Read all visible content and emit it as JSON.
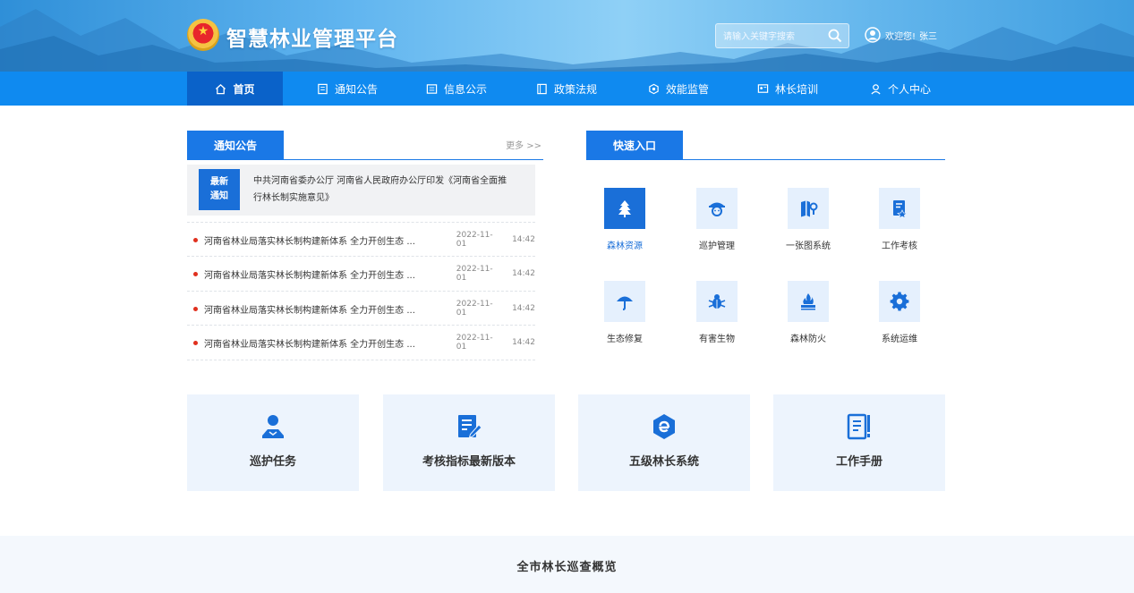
{
  "header": {
    "app_title": "智慧林业管理平台",
    "search_placeholder": "请输入关键字搜索",
    "welcome": "欢迎您!",
    "username": "张三"
  },
  "nav": {
    "items": [
      {
        "label": "首页",
        "icon": "home-icon"
      },
      {
        "label": "通知公告",
        "icon": "notice-icon"
      },
      {
        "label": "信息公示",
        "icon": "info-icon"
      },
      {
        "label": "政策法规",
        "icon": "policy-icon"
      },
      {
        "label": "效能监管",
        "icon": "supervision-icon"
      },
      {
        "label": "林长培训",
        "icon": "training-icon"
      },
      {
        "label": "个人中心",
        "icon": "user-icon"
      }
    ],
    "active": "首页"
  },
  "notice": {
    "section_title": "通知公告",
    "more": "更多 >>",
    "featured_badge_line1": "最新",
    "featured_badge_line2": "通知",
    "featured_text": "中共河南省委办公厅 河南省人民政府办公厅印发《河南省全面推行林长制实施意见》",
    "items": [
      {
        "title": "河南省林业局落实林长制构建新体系 全力开创生态 ...",
        "date": "2022-11-01",
        "time": "14:42"
      },
      {
        "title": "河南省林业局落实林长制构建新体系 全力开创生态 ...",
        "date": "2022-11-01",
        "time": "14:42"
      },
      {
        "title": "河南省林业局落实林长制构建新体系 全力开创生态 ...",
        "date": "2022-11-01",
        "time": "14:42"
      },
      {
        "title": "河南省林业局落实林长制构建新体系 全力开创生态 ...",
        "date": "2022-11-01",
        "time": "14:42"
      }
    ]
  },
  "quick_entry": {
    "section_title": "快速入口",
    "items": [
      {
        "label": "森林资源",
        "icon": "tree-icon",
        "active": true
      },
      {
        "label": "巡护管理",
        "icon": "ranger-icon"
      },
      {
        "label": "一张图系统",
        "icon": "map-icon"
      },
      {
        "label": "工作考核",
        "icon": "assessment-icon"
      },
      {
        "label": "生态修复",
        "icon": "umbrella-icon"
      },
      {
        "label": "有害生物",
        "icon": "bug-icon"
      },
      {
        "label": "森林防火",
        "icon": "fire-icon"
      },
      {
        "label": "系统运维",
        "icon": "gear-icon"
      }
    ]
  },
  "cards": [
    {
      "label": "巡护任务",
      "icon": "patrol-task-icon"
    },
    {
      "label": "考核指标最新版本",
      "icon": "edit-doc-icon"
    },
    {
      "label": "五级林长系统",
      "icon": "system-e-icon"
    },
    {
      "label": "工作手册",
      "icon": "manual-icon"
    }
  ],
  "overview": {
    "title": "全市林长巡查概览"
  },
  "colors": {
    "primary": "#1a78e6",
    "nav": "#0f8af0",
    "nav_active": "#0a62c9",
    "card_bg": "#edf4fd",
    "dot": "#e0301e"
  }
}
